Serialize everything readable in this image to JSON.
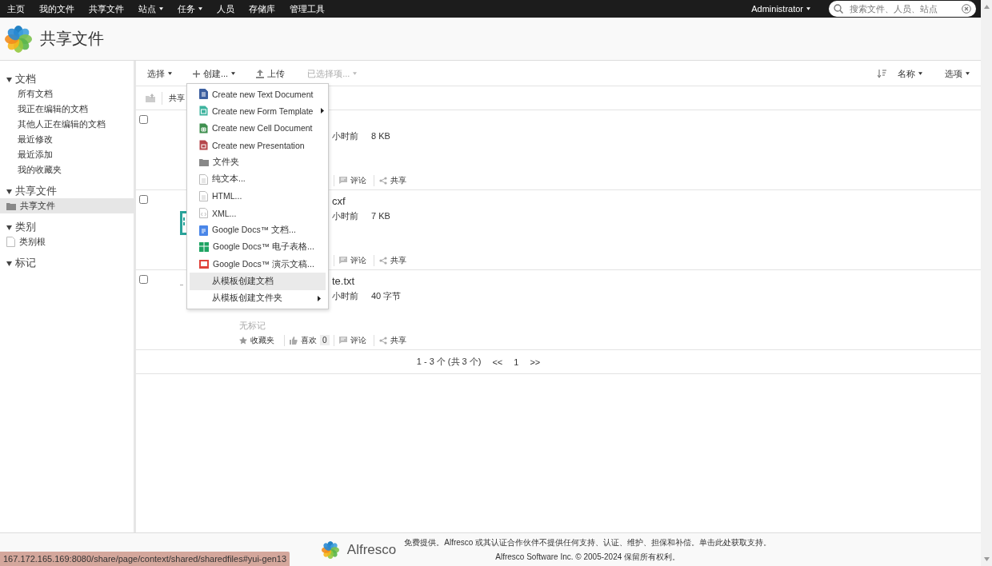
{
  "topbar": {
    "nav": [
      {
        "label": "主页",
        "dropdown": false
      },
      {
        "label": "我的文件",
        "dropdown": false
      },
      {
        "label": "共享文件",
        "dropdown": false
      },
      {
        "label": "站点",
        "dropdown": true
      },
      {
        "label": "任务",
        "dropdown": true
      },
      {
        "label": "人员",
        "dropdown": false
      },
      {
        "label": "存储库",
        "dropdown": false
      },
      {
        "label": "管理工具",
        "dropdown": false
      }
    ],
    "user": "Administrator",
    "search": {
      "placeholder": "搜索文件、人员、站点"
    }
  },
  "header": {
    "title": "共享文件"
  },
  "sidebar": {
    "sections": [
      {
        "title": "文档",
        "expanded": true,
        "items": [
          {
            "label": "所有文档",
            "selected": false,
            "kind": "link"
          },
          {
            "label": "我正在编辑的文档",
            "selected": false,
            "kind": "link"
          },
          {
            "label": "其他人正在编辑的文档",
            "selected": false,
            "kind": "link"
          },
          {
            "label": "最近修改",
            "selected": false,
            "kind": "link"
          },
          {
            "label": "最近添加",
            "selected": false,
            "kind": "link"
          },
          {
            "label": "我的收藏夹",
            "selected": false,
            "kind": "link"
          }
        ]
      },
      {
        "title": "共享文件",
        "expanded": true,
        "items": [
          {
            "label": "共享文件",
            "selected": true,
            "kind": "folder"
          }
        ]
      },
      {
        "title": "类别",
        "expanded": true,
        "items": [
          {
            "label": "类别根",
            "selected": false,
            "kind": "category"
          }
        ]
      },
      {
        "title": "标记",
        "expanded": true
      }
    ]
  },
  "toolbar": {
    "left": [
      {
        "label": "选择",
        "kind": "menu",
        "disabled": false
      },
      {
        "label": "创建...",
        "kind": "create",
        "disabled": false
      },
      {
        "label": "上传",
        "kind": "upload",
        "disabled": false
      },
      {
        "label": "已选择项...",
        "kind": "menu",
        "disabled": true
      }
    ],
    "right": [
      {
        "label": "名称",
        "kind": "sort"
      },
      {
        "label": "选项",
        "kind": "menu"
      }
    ]
  },
  "breadcrumb": {
    "label": "共享"
  },
  "create_menu": {
    "items": [
      {
        "label": "Create new Text Document",
        "kind": "text",
        "submenu": false,
        "selected": false
      },
      {
        "label": "Create new Form Template",
        "kind": "form",
        "submenu": true,
        "selected": false
      },
      {
        "label": "Create new Cell Document",
        "kind": "cell",
        "submenu": false,
        "selected": false
      },
      {
        "label": "Create new Presentation",
        "kind": "presentation",
        "submenu": false,
        "selected": false
      },
      {
        "label": "文件夹",
        "kind": "folder",
        "submenu": false,
        "selected": false
      },
      {
        "label": "纯文本...",
        "kind": "file",
        "submenu": false,
        "selected": false
      },
      {
        "label": "HTML...",
        "kind": "file",
        "submenu": false,
        "selected": false
      },
      {
        "label": "XML...",
        "kind": "xml",
        "submenu": false,
        "selected": false
      },
      {
        "label": "Google Docs™ 文档...",
        "kind": "gdoc",
        "submenu": false,
        "selected": false
      },
      {
        "label": "Google Docs™ 电子表格...",
        "kind": "gsheet",
        "submenu": false,
        "selected": false
      },
      {
        "label": "Google Docs™ 演示文稿...",
        "kind": "gslides",
        "submenu": false,
        "selected": false
      },
      {
        "label": "从模板创建文档",
        "kind": "template",
        "submenu": false,
        "selected": true
      },
      {
        "label": "从模板创建文件夹",
        "kind": "template",
        "submenu": true,
        "selected": false
      }
    ]
  },
  "documents": [
    {
      "checked": false,
      "kind": "hidden",
      "meta": "小时前",
      "size": "8 KB",
      "actions": [
        {
          "kind": "comment",
          "label": "评论"
        },
        {
          "kind": "share",
          "label": "共享"
        }
      ]
    },
    {
      "checked": false,
      "kind": "file",
      "name": "cxf",
      "meta": "小时前",
      "size": "7 KB",
      "actions": [
        {
          "kind": "comment",
          "label": "评论"
        },
        {
          "kind": "share",
          "label": "共享"
        }
      ]
    },
    {
      "checked": false,
      "kind": "dash",
      "name": "te.txt",
      "meta": "小时前",
      "size": "40 字节",
      "tags": "无标记",
      "actions": [
        {
          "kind": "favorite",
          "label": "收藏夹"
        },
        {
          "kind": "like",
          "label": "喜欢",
          "count": "0"
        },
        {
          "kind": "comment",
          "label": "评论"
        },
        {
          "kind": "share",
          "label": "共享"
        }
      ]
    }
  ],
  "pagination": {
    "summary": "1 - 3 个 (共 3 个)",
    "prev": "<<",
    "page": "1",
    "next": ">>"
  },
  "footer": {
    "logo": "Alfresco",
    "notice": "免费提供。Alfresco 或其认证合作伙伴不提供任何支持、认证、维护、担保和补偿。单击此处获取支持。",
    "copyright": "Alfresco Software Inc. © 2005-2024 保留所有权利。"
  },
  "status_url": "167.172.165.169:8080/share/page/context/shared/sharedfiles#yui-gen13"
}
